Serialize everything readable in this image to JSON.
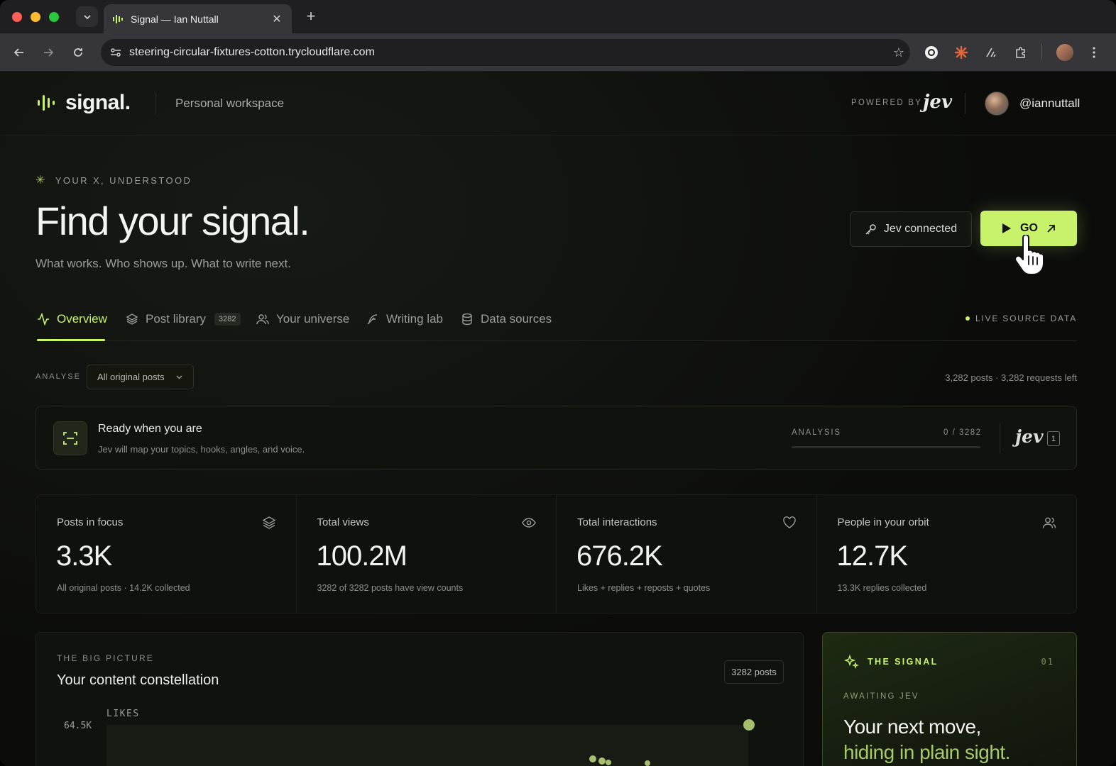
{
  "browser": {
    "tab_title": "Signal — Ian Nuttall",
    "url": "steering-circular-fixtures-cotton.trycloudflare.com"
  },
  "header": {
    "brand": "signal.",
    "workspace": "Personal workspace",
    "powered_by": "POWERED BY",
    "powered_logo": "jev",
    "username": "@iannuttall"
  },
  "hero": {
    "eyebrow": "YOUR X, UNDERSTOOD",
    "title": "Find your signal.",
    "subtitle": "What works. Who shows up. What to write next.",
    "connected_label": "Jev connected",
    "go_label": "GO"
  },
  "tabs": [
    {
      "label": "Overview",
      "icon": "activity-icon",
      "active": true
    },
    {
      "label": "Post library",
      "icon": "layers-icon",
      "badge": "3282"
    },
    {
      "label": "Your universe",
      "icon": "users-icon"
    },
    {
      "label": "Writing lab",
      "icon": "feather-icon"
    },
    {
      "label": "Data sources",
      "icon": "database-icon"
    }
  ],
  "live_label": "LIVE SOURCE DATA",
  "filter": {
    "label": "ANALYSE",
    "selected": "All original posts",
    "counts": "3,282 posts · 3,282 requests left"
  },
  "ready": {
    "title": "Ready when you are",
    "subtitle": "Jev will map your topics, hooks, angles, and voice.",
    "analysis_label": "ANALYSIS",
    "analysis_count": "0 / 3282",
    "analysis_progress": 0,
    "jev_logo": "jev",
    "jev_badge": "1"
  },
  "stats": [
    {
      "label": "Posts in focus",
      "value": "3.3K",
      "note": "All original posts · 14.2K collected",
      "icon": "layers-icon"
    },
    {
      "label": "Total views",
      "value": "100.2M",
      "note": "3282 of 3282 posts have view counts",
      "icon": "eye-icon"
    },
    {
      "label": "Total interactions",
      "value": "676.2K",
      "note": "Likes + replies + reposts + quotes",
      "icon": "heart-icon"
    },
    {
      "label": "People in your orbit",
      "value": "12.7K",
      "note": "13.3K replies collected",
      "icon": "users-icon"
    }
  ],
  "big_picture": {
    "eyebrow": "THE BIG PICTURE",
    "title": "Your content constellation",
    "pill": "3282 posts",
    "y_label": "LIKES",
    "y_tick": "64.5K"
  },
  "signal": {
    "eyebrow": "THE SIGNAL",
    "number": "01",
    "status": "AWAITING JEV",
    "line1": "Your next move,",
    "line2": "hiding in plain sight."
  },
  "colors": {
    "accent": "#c9f26b",
    "background": "#0c0d0b"
  }
}
